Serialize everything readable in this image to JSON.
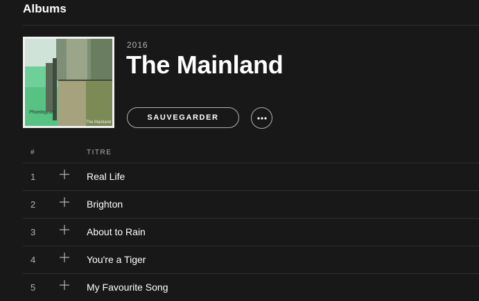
{
  "section": {
    "title": "Albums"
  },
  "album": {
    "year": "2016",
    "title": "The Mainland",
    "cover_band_text": "Phantogram",
    "cover_album_text": "The Mainland"
  },
  "actions": {
    "save_label": "SAUVEGARDER",
    "more_icon": "more-icon"
  },
  "tracklist": {
    "header_num": "#",
    "header_title": "TITRE",
    "tracks": [
      {
        "num": "1",
        "title": "Real Life"
      },
      {
        "num": "2",
        "title": "Brighton"
      },
      {
        "num": "3",
        "title": "About to Rain"
      },
      {
        "num": "4",
        "title": "You're a Tiger"
      },
      {
        "num": "5",
        "title": "My Favourite Song"
      }
    ]
  }
}
